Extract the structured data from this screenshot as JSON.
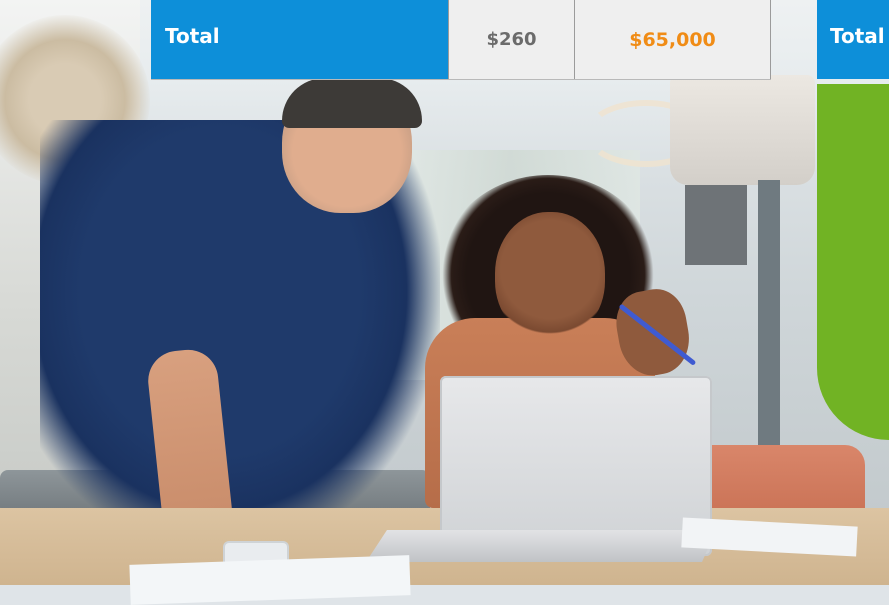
{
  "pricing_table": {
    "total_label": "Total",
    "price_value": "$260",
    "total_value": "$65,000"
  },
  "right_panel": {
    "total_label": "Total"
  },
  "colors": {
    "header_blue": "#0d8fd9",
    "highlight_orange": "#f08c16",
    "accent_green": "#71b324",
    "cell_gray": "#efefef"
  },
  "photo": {
    "icon": "office-photo"
  }
}
